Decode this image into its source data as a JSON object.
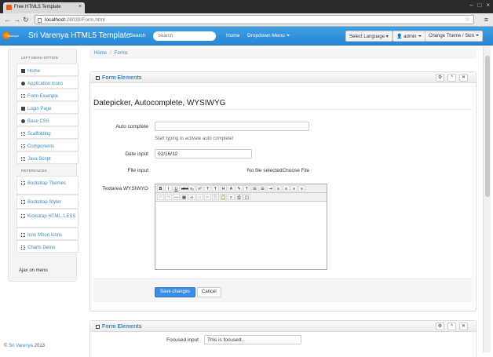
{
  "browser": {
    "tab_title": "Free HTML5 Template",
    "url_host": "localhost",
    "url_path": ":28039/Form.html"
  },
  "navbar": {
    "brand": "Sri Varenya HTML5 Template",
    "logo_text": "Varenya",
    "search_label": "Search",
    "search_placeholder": "Search",
    "home": "Home",
    "dropdown_menu": "Dropdown Menu",
    "select_language": "Select Language",
    "admin": "admin",
    "change_theme": "Change Theme / Skin"
  },
  "sidebar": {
    "header_left_menu": "LEFT MENU OPTION",
    "items": [
      {
        "label": "Home",
        "icon": "home-icon"
      },
      {
        "label": "Application Icons",
        "icon": "globe-icon"
      },
      {
        "label": "Form Example",
        "icon": "edit-icon"
      },
      {
        "label": "Login Page",
        "icon": "lock-icon"
      },
      {
        "label": "Base CSS",
        "icon": "eye-icon"
      },
      {
        "label": "Scaffolding",
        "icon": "edit-icon"
      },
      {
        "label": "Components",
        "icon": "list-icon"
      },
      {
        "label": "Java Script",
        "icon": "font-icon"
      }
    ],
    "header_references": "REFERENCES",
    "references": [
      {
        "label": "Bootstrap Themes",
        "icon": "grid-icon"
      },
      {
        "label": "Bootstrap Styler",
        "icon": "grid-icon"
      },
      {
        "label": "Kickstrap HTML, LESS",
        "icon": "grid-icon"
      },
      {
        "label": "Icon Moon Icons",
        "icon": "grid-icon"
      },
      {
        "label": "Charts Demo",
        "icon": "grid-icon"
      }
    ],
    "ajax_menu": "Ajax on menu"
  },
  "breadcrumb": {
    "home": "Home",
    "current": "Forms"
  },
  "box1": {
    "title": "Form Elements",
    "heading": "Datepicker, Autocomplete, WYSIWYG",
    "autocomplete_label": "Auto complete",
    "autocomplete_value": "",
    "autocomplete_help": "Start typing to activate auto complete!",
    "date_label": "Date input",
    "date_value": "02/16/12",
    "file_label": "File input",
    "file_text": "No file selectedChoose File",
    "textarea_label": "Textarea WYSIWYG",
    "save_label": "Save changes",
    "cancel_label": "Cancel"
  },
  "box2": {
    "title": "Form Elements",
    "focused_label": "Focused input",
    "focused_value": "This is focused..."
  },
  "footer": {
    "copyright": "©",
    "link": "Sri Varenya",
    "year": "2013"
  },
  "colors": {
    "navbar": "#2a86d4",
    "link": "#3a87c9",
    "primary_button": "#3a8ee6"
  }
}
